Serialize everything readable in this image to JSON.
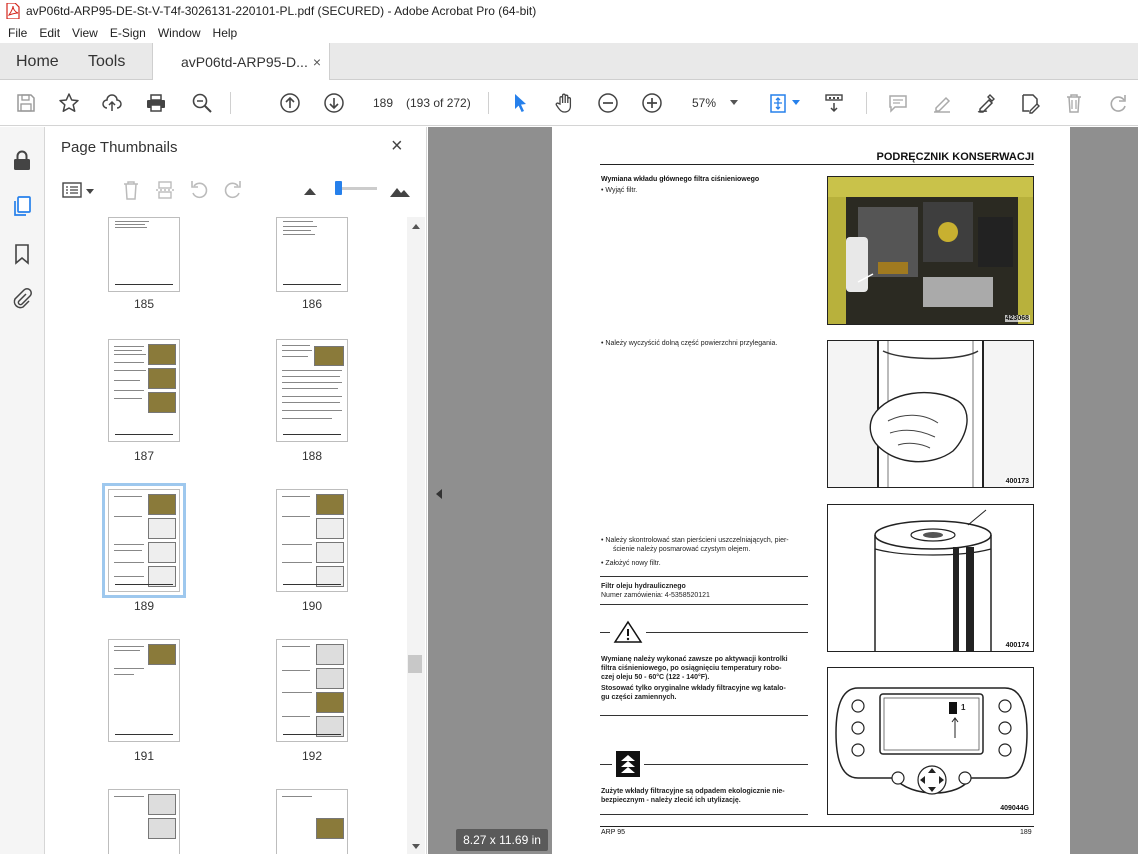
{
  "window": {
    "title": "avP06td-ARP95-DE-St-V-T4f-3026131-220101-PL.pdf (SECURED) - Adobe Acrobat Pro (64-bit)"
  },
  "menu": [
    "File",
    "Edit",
    "View",
    "E-Sign",
    "Window",
    "Help"
  ],
  "tabs": {
    "home": "Home",
    "tools": "Tools",
    "document": "avP06td-ARP95-D...",
    "close_glyph": "×"
  },
  "toolbar": {
    "page_number": "189",
    "page_count": "(193 of 272)",
    "zoom": "57%"
  },
  "thumbnails_panel": {
    "title": "Page Thumbnails",
    "close_glyph": "×",
    "pages": [
      {
        "label": "185"
      },
      {
        "label": "186"
      },
      {
        "label": "187"
      },
      {
        "label": "188"
      },
      {
        "label": "189",
        "selected": true
      },
      {
        "label": "190"
      },
      {
        "label": "191"
      },
      {
        "label": "192"
      }
    ]
  },
  "document": {
    "page_size": "8.27 x 11.69 in",
    "header": "PODRĘCZNIK KONSERWACJI",
    "section_heading": "Wymiana wkładu głównego filtra ciśnieniowego",
    "step1": "•   Wyjąć filtr.",
    "step2": "•   Należy wyczyścić dolną część powierzchni przylegania.",
    "step3a": "•   Należy skontrolować stan pierścieni uszczelniających, pier-",
    "step3b": "ścienie należy posmarować czystym olejem.",
    "step4": "•   Założyć nowy filtr.",
    "filter_title": "Filtr oleju hydraulicznego",
    "order_number": "Numer zamówienia: 4-5358520121",
    "warning_lines": [
      "Wymianę należy wykonać zawsze po aktywacji kontrolki",
      "filtra ciśnieniowego, po osiągnięciu temperatury robo-",
      "czej oleju 50 - 60°C (122 - 140°F).",
      "Stosować tylko oryginalne wkłady filtracyjne wg katalo-",
      "gu części zamiennych."
    ],
    "eco_lines": [
      "Zużyte wkłady filtracyjne są odpadem ekologicznie nie-",
      "bezpiecznym - należy zlecić ich utylizację."
    ],
    "photo_captions": [
      "423068",
      "400173",
      "400174",
      "409044G"
    ],
    "display_indicator": "1",
    "footer_left": "ARP 95",
    "footer_right": "189"
  },
  "colors": {
    "pdf_icon": "#d4261c",
    "accent": "#2680eb",
    "selection": "#9ec8ee",
    "doc_background": "#8f8f8f"
  }
}
